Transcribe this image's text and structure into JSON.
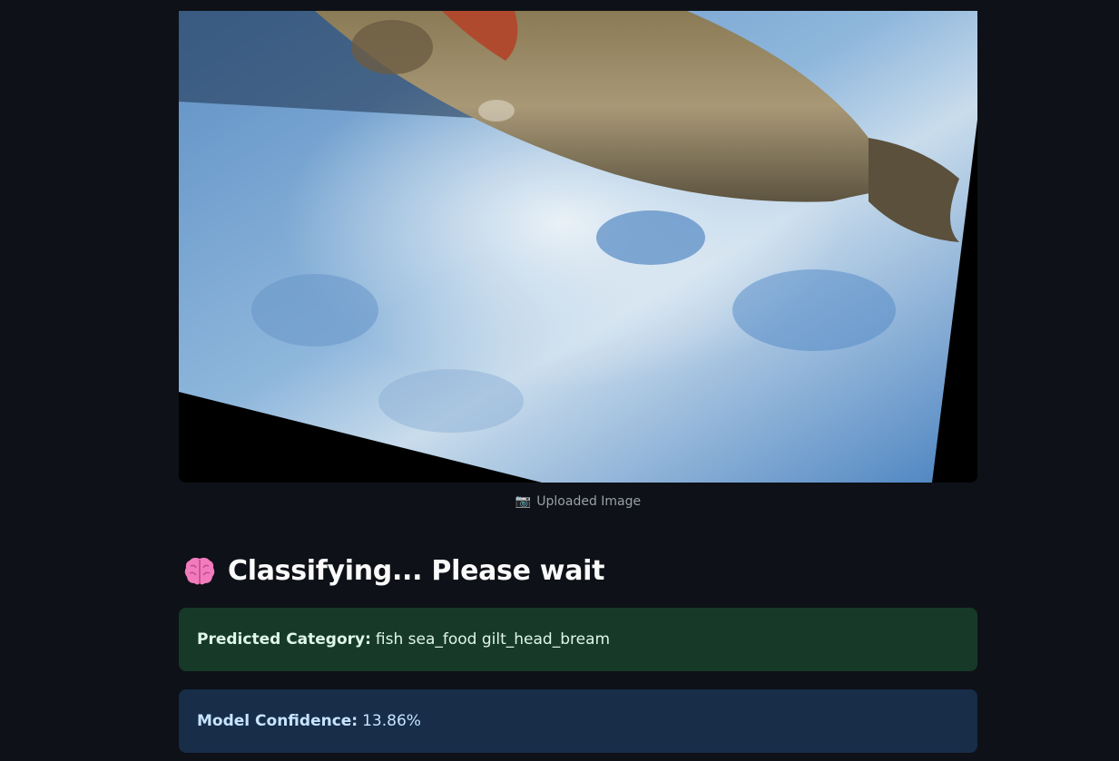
{
  "image": {
    "alt": "",
    "caption_icon": "camera-icon",
    "caption_emoji": "📷",
    "caption": "Uploaded Image"
  },
  "status": {
    "icon": "brain-icon",
    "heading": "Classifying... Please wait"
  },
  "prediction": {
    "label": "Predicted Category:",
    "value": "fish sea_food gilt_head_bream",
    "color": "#173928"
  },
  "confidence": {
    "label": "Model Confidence:",
    "value": "13.86%",
    "color": "#172d48"
  },
  "colors": {
    "background": "#0e1117",
    "success_bg": "#173928",
    "info_bg": "#172d48"
  }
}
